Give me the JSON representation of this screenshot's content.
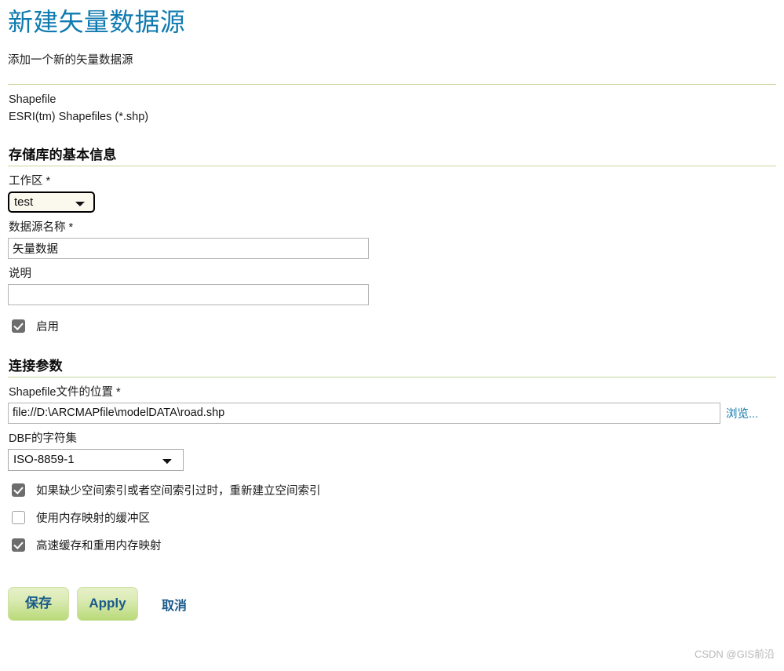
{
  "header": {
    "title": "新建矢量数据源",
    "subtitle": "添加一个新的矢量数据源",
    "format_name": "Shapefile",
    "format_description": "ESRI(tm) Shapefiles (*.shp)"
  },
  "basic_info": {
    "heading": "存储库的基本信息",
    "workspace": {
      "label": "工作区",
      "required_mark": "*",
      "value": "test",
      "options": [
        "test"
      ]
    },
    "datasource_name": {
      "label": "数据源名称",
      "required_mark": "*",
      "value": "矢量数据",
      "placeholder": ""
    },
    "description": {
      "label": "说明",
      "value": "",
      "placeholder": ""
    },
    "enabled": {
      "label": "启用",
      "checked": true
    }
  },
  "connection_params": {
    "heading": "连接参数",
    "shapefile_location": {
      "label": "Shapefile文件的位置",
      "required_mark": "*",
      "value": "file://D:\\ARCMAPfile\\modelDATA\\road.shp",
      "placeholder": "",
      "browse_label": "浏览..."
    },
    "dbf_charset": {
      "label": "DBF的字符集",
      "value": "ISO-8859-1",
      "options": [
        "ISO-8859-1"
      ]
    },
    "options": [
      {
        "label": "如果缺少空间索引或者空间索引过时，重新建立空间索引",
        "checked": true
      },
      {
        "label": "使用内存映射的缓冲区",
        "checked": false
      },
      {
        "label": "高速缓存和重用内存映射",
        "checked": true
      }
    ]
  },
  "footer": {
    "save_label": "保存",
    "apply_label": "Apply",
    "cancel_label": "取消",
    "watermark": "CSDN @GIS前沿"
  },
  "colors": {
    "title_blue": "#0f7ab0",
    "rule_green": "#c6d69a",
    "button_green_top": "#e6f0c8",
    "button_green_bottom": "#b9da79",
    "button_text_blue": "#1a5a8a",
    "checkbox_gray": "#6d6d6d",
    "link_blue": "#0f7ab0",
    "watermark_gray": "#b8b8b8"
  }
}
